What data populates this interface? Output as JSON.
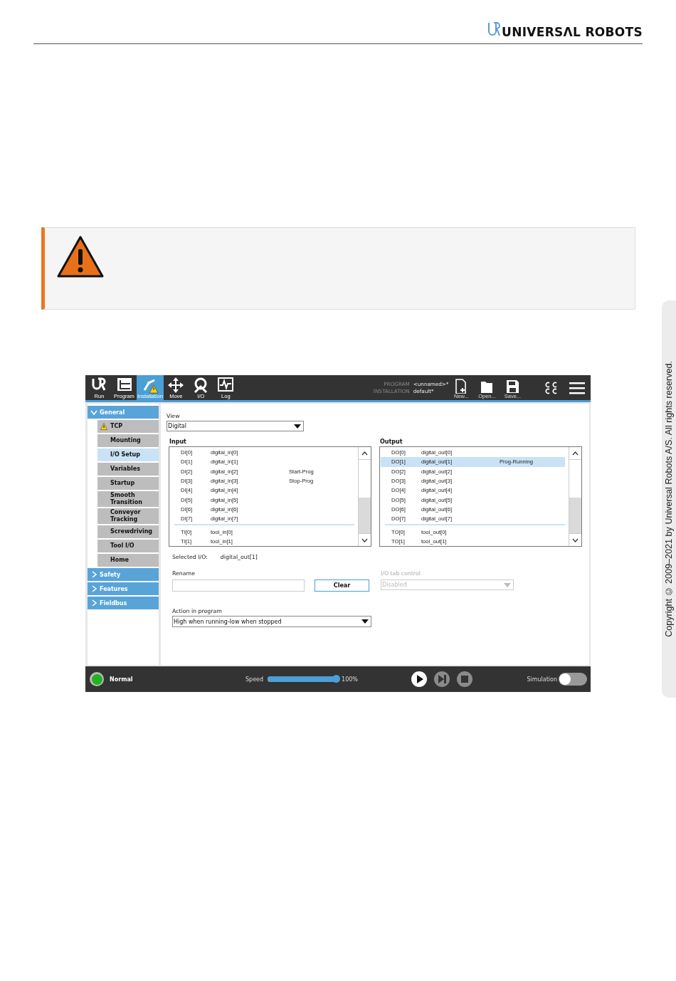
{
  "header": {
    "logo_text": "UNIVERSΛL ROBOTS"
  },
  "side_note": {
    "text": "Copyright © 2009–2021 by Universal Robots A/S. All rights reserved."
  },
  "app": {
    "toolbar": {
      "tabs": [
        {
          "label": "Run",
          "selected": false
        },
        {
          "label": "Program",
          "selected": false
        },
        {
          "label": "Installation",
          "selected": true,
          "warning": true
        },
        {
          "label": "Move",
          "selected": false
        },
        {
          "label": "I/O",
          "selected": false
        },
        {
          "label": "Log",
          "selected": false
        }
      ],
      "program_label": "PROGRAM",
      "program_value": "<unnamed>*",
      "installation_label": "INSTALLATION",
      "installation_value": "default*",
      "file_buttons": [
        {
          "kind": "new",
          "label": "New..."
        },
        {
          "kind": "open",
          "label": "Open..."
        },
        {
          "kind": "save",
          "label": "Save..."
        }
      ]
    },
    "sidebar": [
      {
        "label": "General",
        "expanded": true,
        "children": [
          {
            "label": "TCP",
            "selected": false,
            "warning": true
          },
          {
            "label": "Mounting",
            "selected": false,
            "warning": false
          },
          {
            "label": "I/O Setup",
            "selected": true,
            "warning": false
          },
          {
            "label": "Variables",
            "selected": false,
            "warning": false
          },
          {
            "label": "Startup",
            "selected": false,
            "warning": false
          },
          {
            "label": "Smooth Transition",
            "selected": false,
            "warning": false
          },
          {
            "label": "Conveyor Tracking",
            "selected": false,
            "warning": false
          },
          {
            "label": "Screwdriving",
            "selected": false,
            "warning": false
          },
          {
            "label": "Tool I/O",
            "selected": false,
            "warning": false
          },
          {
            "label": "Home",
            "selected": false,
            "warning": false
          }
        ]
      },
      {
        "label": "Safety",
        "expanded": false
      },
      {
        "label": "Features",
        "expanded": false
      },
      {
        "label": "Fieldbus",
        "expanded": false
      }
    ],
    "view": {
      "label": "View",
      "value": "Digital"
    },
    "lists": [
      {
        "title": "Input",
        "sections": [
          {
            "rows": [
              {
                "id": "DI[0]",
                "name": "digital_in[0]",
                "selected": false
              },
              {
                "id": "DI[1]",
                "name": "digital_in[1]",
                "selected": false
              },
              {
                "id": "DI[2]",
                "name": "digital_in[2]",
                "function": "Start-Prog",
                "selected": false
              },
              {
                "id": "DI[3]",
                "name": "digital_in[3]",
                "function": "Stop-Prog",
                "selected": false
              },
              {
                "id": "DI[4]",
                "name": "digital_in[4]",
                "selected": false
              },
              {
                "id": "DI[5]",
                "name": "digital_in[5]",
                "selected": false
              },
              {
                "id": "DI[6]",
                "name": "digital_in[6]",
                "selected": false
              },
              {
                "id": "DI[7]",
                "name": "digital_in[7]",
                "selected": false
              }
            ]
          },
          {
            "rows": [
              {
                "id": "TI[0]",
                "name": "tool_in[0]",
                "selected": false
              },
              {
                "id": "TI[1]",
                "name": "tool_in[1]",
                "selected": false
              }
            ]
          }
        ]
      },
      {
        "title": "Output",
        "sections": [
          {
            "rows": [
              {
                "id": "DO[0]",
                "name": "digital_out[0]",
                "selected": false
              },
              {
                "id": "DO[1]",
                "name": "digital_out[1]",
                "function": "Prog-Running",
                "selected": true
              },
              {
                "id": "DO[2]",
                "name": "digital_out[2]",
                "selected": false
              },
              {
                "id": "DO[3]",
                "name": "digital_out[3]",
                "selected": false
              },
              {
                "id": "DO[4]",
                "name": "digital_out[4]",
                "selected": false
              },
              {
                "id": "DO[5]",
                "name": "digital_out[5]",
                "selected": false
              },
              {
                "id": "DO[6]",
                "name": "digital_out[6]",
                "selected": false
              },
              {
                "id": "DO[7]",
                "name": "digital_out[7]",
                "selected": false
              }
            ]
          },
          {
            "rows": [
              {
                "id": "TO[0]",
                "name": "tool_out[0]",
                "selected": false
              },
              {
                "id": "TO[1]",
                "name": "tool_out[1]",
                "selected": false
              }
            ]
          }
        ]
      }
    ],
    "selected_io": {
      "label": "Selected I/O:",
      "value": "digital_out[1]"
    },
    "rename": {
      "label": "Rename",
      "button": "Clear"
    },
    "tab_control": {
      "label": "I/O tab control",
      "value": "Disabled",
      "disabled": true
    },
    "action": {
      "label": "Action in program",
      "value": "High when running-low when stopped"
    },
    "footer": {
      "status": "Normal",
      "speed_label": "Speed",
      "speed": {
        "level": 1.0
      },
      "speed_reading": "100%",
      "controls": [
        {
          "kind": "play",
          "disabled": false
        },
        {
          "kind": "step",
          "disabled": true
        },
        {
          "kind": "stop",
          "disabled": true
        }
      ],
      "simulation_label": "Simulation",
      "simulation": {
        "on": false
      }
    }
  }
}
